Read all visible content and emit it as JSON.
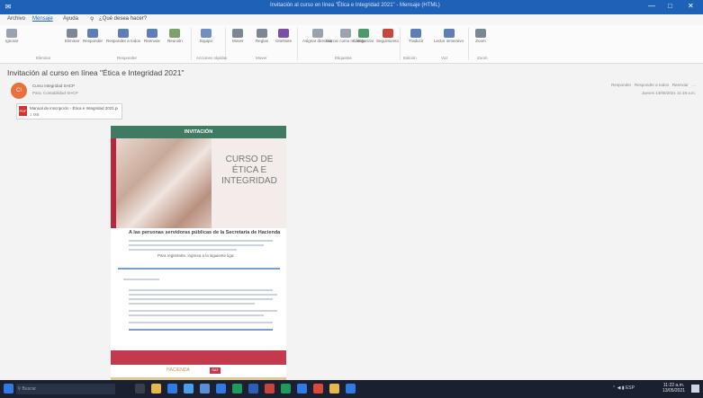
{
  "window": {
    "title": "Invitación al curso en línea \"Ética e Integridad 2021\" - Mensaje (HTML)",
    "controls": [
      "—",
      "□",
      "✕"
    ]
  },
  "menu": {
    "items": [
      "Archivo",
      "Mensaje",
      "Ayuda",
      "¿Qué desea hacer?"
    ]
  },
  "ribbon": {
    "buttons": [
      {
        "label": "Ignorar",
        "color": "#9aa3ad"
      },
      {
        "label": "Eliminar",
        "color": "#7d8794"
      },
      {
        "label": "Responder",
        "color": "#5b7fb6"
      },
      {
        "label": "Responder a todos",
        "color": "#5b7fb6"
      },
      {
        "label": "Reenviar",
        "color": "#5b7fb6"
      },
      {
        "label": "Reunión",
        "color": "#7ea06c"
      },
      {
        "label": "Equipo",
        "color": "#6f8fc1"
      },
      {
        "label": "Mover",
        "color": "#7d8794"
      },
      {
        "label": "Reglas",
        "color": "#7d8794"
      },
      {
        "label": "OneNote",
        "color": "#7b4fa8"
      },
      {
        "label": "Asignar directiva",
        "color": "#9aa3ad"
      },
      {
        "label": "Marcar como no leído",
        "color": "#9aa3ad"
      },
      {
        "label": "Categorizar",
        "color": "#4a9a6b"
      },
      {
        "label": "Seguimiento",
        "color": "#c8453b"
      },
      {
        "label": "Traducir",
        "color": "#5b7fb6"
      },
      {
        "label": "Lector inmersivo",
        "color": "#5b7fb6"
      },
      {
        "label": "Zoom",
        "color": "#7d8794"
      }
    ],
    "groups": [
      "Eliminar",
      "Responder",
      "Acciones rápidas",
      "Mover",
      "Etiquetas",
      "Edición",
      "Voz",
      "Zoom"
    ]
  },
  "email": {
    "subject": "Invitación al curso en línea \"Ética e Integridad 2021\"",
    "sender": "Curso Integridad SHCP",
    "to": "Para: Contabilidad SHCP",
    "avatar_initials": "CI",
    "attachment_name": "Manual de inscripción - Ética e Integridad 2021.pdf",
    "attachment_size": "1 MB",
    "actions": [
      "Responder",
      "Responder a todos",
      "Reenviar"
    ],
    "date": "Jueves 13/05/2021 11:18 a.m."
  },
  "card": {
    "banner": "INVITACIÓN",
    "course_title": "CURSO DE ÉTICA E INTEGRIDAD",
    "greeting": "A las personas servidoras públicas de la Secretaría de Hacienda y Crédito Público",
    "register_text": "Para registrarte, ingresa a la siguiente liga:",
    "footer_logo_1": "HACIENDA",
    "footer_logo_2": "SAT"
  },
  "taskbar": {
    "search_placeholder": "Buscar",
    "time": "11:22 a.m.",
    "date": "13/05/2021",
    "lang": "ESP"
  }
}
